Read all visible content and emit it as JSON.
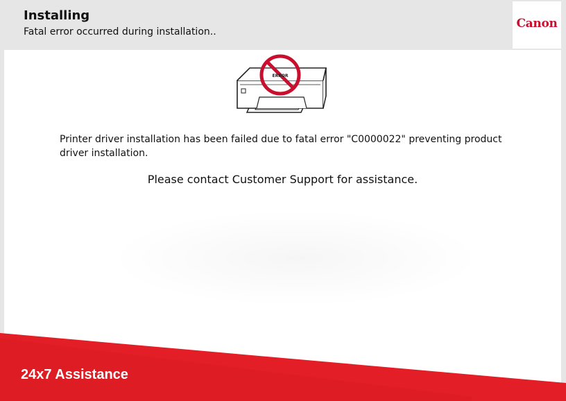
{
  "header": {
    "title": "Installing",
    "subtitle": "Fatal error occurred during installation..",
    "logo": "Canon"
  },
  "illustration": {
    "icon": "printer-error-icon",
    "label": "ERROR"
  },
  "main": {
    "message": "Printer driver installation has been failed due to fatal error \"C0000022\" preventing product driver installation.",
    "contact": "Please contact Customer Support for assistance."
  },
  "banner": {
    "text": "24x7 Assistance"
  },
  "colors": {
    "accent": "#e41e26",
    "brand": "#c8102e",
    "header_bg": "#e6e6e6"
  }
}
